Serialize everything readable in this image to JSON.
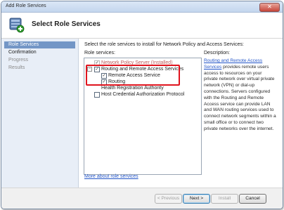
{
  "window": {
    "title": "Add Role Services",
    "close_glyph": "✕"
  },
  "header": {
    "title": "Select Role Services",
    "icon": "role-services-add-icon"
  },
  "sidebar": {
    "items": [
      {
        "label": "Role Services",
        "state": "active"
      },
      {
        "label": "Confirmation",
        "state": "normal"
      },
      {
        "label": "Progress",
        "state": "dim"
      },
      {
        "label": "Results",
        "state": "dim"
      }
    ]
  },
  "main": {
    "instruction": "Select the role services to install for Network Policy and Access Services:",
    "role_services_label": "Role services:",
    "description_label": "Description:",
    "tree": [
      {
        "label": "Network Policy Server  (Installed)",
        "checked": true,
        "installed": true
      },
      {
        "label": "Routing and Remote Access Services",
        "checked": true,
        "expanded": true
      },
      {
        "label": "Remote Access Service",
        "checked": true
      },
      {
        "label": "Routing",
        "checked": true
      },
      {
        "label": "Health Registration Authority",
        "checked": false
      },
      {
        "label": "Host Credential Authorization Protocol",
        "checked": false
      }
    ],
    "description": {
      "link": "Routing and Remote Access Services",
      "text": " provides remote users access to resources on your private network over virtual private network (VPN) or dial-up connections. Servers configured with the Routing and Remote Access service can provide LAN and WAN routing services used to connect network segments within a small office or to connect two private networks over the internet."
    },
    "more_link": "More about role services"
  },
  "footer": {
    "previous": "< Previous",
    "next": "Next >",
    "install": "Install",
    "cancel": "Cancel"
  },
  "colors": {
    "highlight": "#e0141e",
    "link": "#2355c8",
    "selected_nav": "#7396c6"
  }
}
